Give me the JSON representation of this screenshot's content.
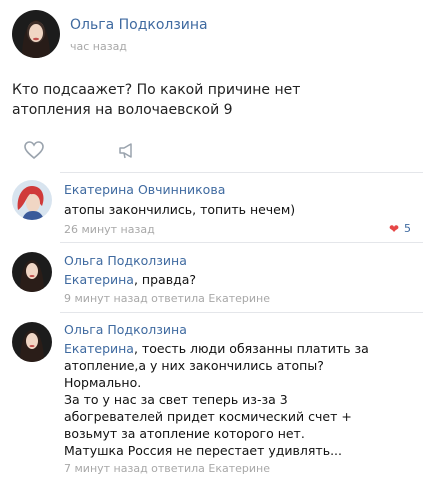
{
  "post": {
    "author": "Ольга Подколзина",
    "time": "час назад",
    "text_lines": [
      "Кто подсаажет? По какой причине нет",
      "атопления на волочаевской 9"
    ]
  },
  "actions": {
    "like_icon": "heart-outline-icon",
    "share_icon": "megaphone-icon"
  },
  "comments": [
    {
      "author": "Екатерина Овчинникова",
      "lines": [
        "атопы закончились, топить нечем)"
      ],
      "meta": "26 минут назад",
      "likes": "5",
      "like_icon": "heart-filled-icon"
    },
    {
      "author": "Ольга Подколзина",
      "mention": "Екатерина",
      "first_line_rest": ", правда?",
      "meta": "9 минут назад ответила Екатерине"
    },
    {
      "author": "Ольга Подколзина",
      "mention": "Екатерина",
      "first_line_rest": ", тоесть люди обязанны платить за",
      "lines": [
        "атопление,а у них закончились атопы?",
        "Нормально.",
        "За то у нас за свет теперь из-за 3",
        "абогревателей придет космический счет +",
        "возьмут за атопление которого нет.",
        "Матушка Россия не перестает удивлять..."
      ],
      "meta": "7 минут назад ответила Екатерине"
    }
  ],
  "colors": {
    "link": "#3f6aa0",
    "meta": "#a8a8a8",
    "like": "#e64646"
  }
}
